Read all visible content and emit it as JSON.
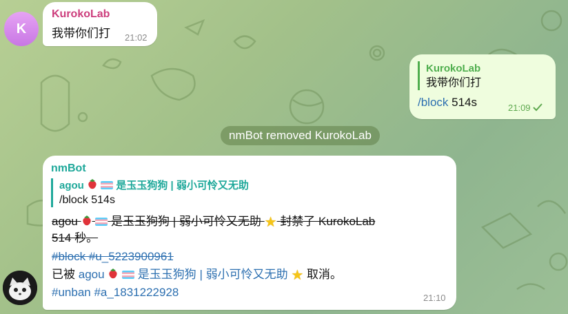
{
  "msg1": {
    "avatar_letter": "K",
    "sender": "KurokoLab",
    "text": "我带你们打",
    "time": "21:02"
  },
  "msg2": {
    "reply_name": "KurokoLab",
    "reply_text": "我带你们打",
    "command": "/block",
    "arg": " 514s",
    "time": "21:09",
    "status_icon": "double-check-icon"
  },
  "service": {
    "text": "nmBot removed KurokoLab"
  },
  "msg3": {
    "sender": "nmBot",
    "reply_name_a": "agou",
    "reply_name_b": "是玉玉狗狗 | 弱小可怜又无助",
    "reply_text": "/block 514s",
    "strike_a": "agou",
    "strike_b": "是玉玉狗狗 | 弱小可怜又无助",
    "strike_c": "封禁了 KurokoLab",
    "strike_d": "514 秒。",
    "strike_tags": "#block #u_5223900961",
    "line_prefix": "已被",
    "line_name_a": "agou",
    "line_name_b": "是玉玉狗狗 | 弱小可怜又无助",
    "line_suffix": "取消。",
    "tags": "#unban #a_1831222928",
    "time": "21:10"
  },
  "colors": {
    "kuroko_name": "#cc3d7c",
    "outgoing_reply": "#4fae4e",
    "bot_name": "#1ea89a",
    "link": "#2c6fb0"
  }
}
